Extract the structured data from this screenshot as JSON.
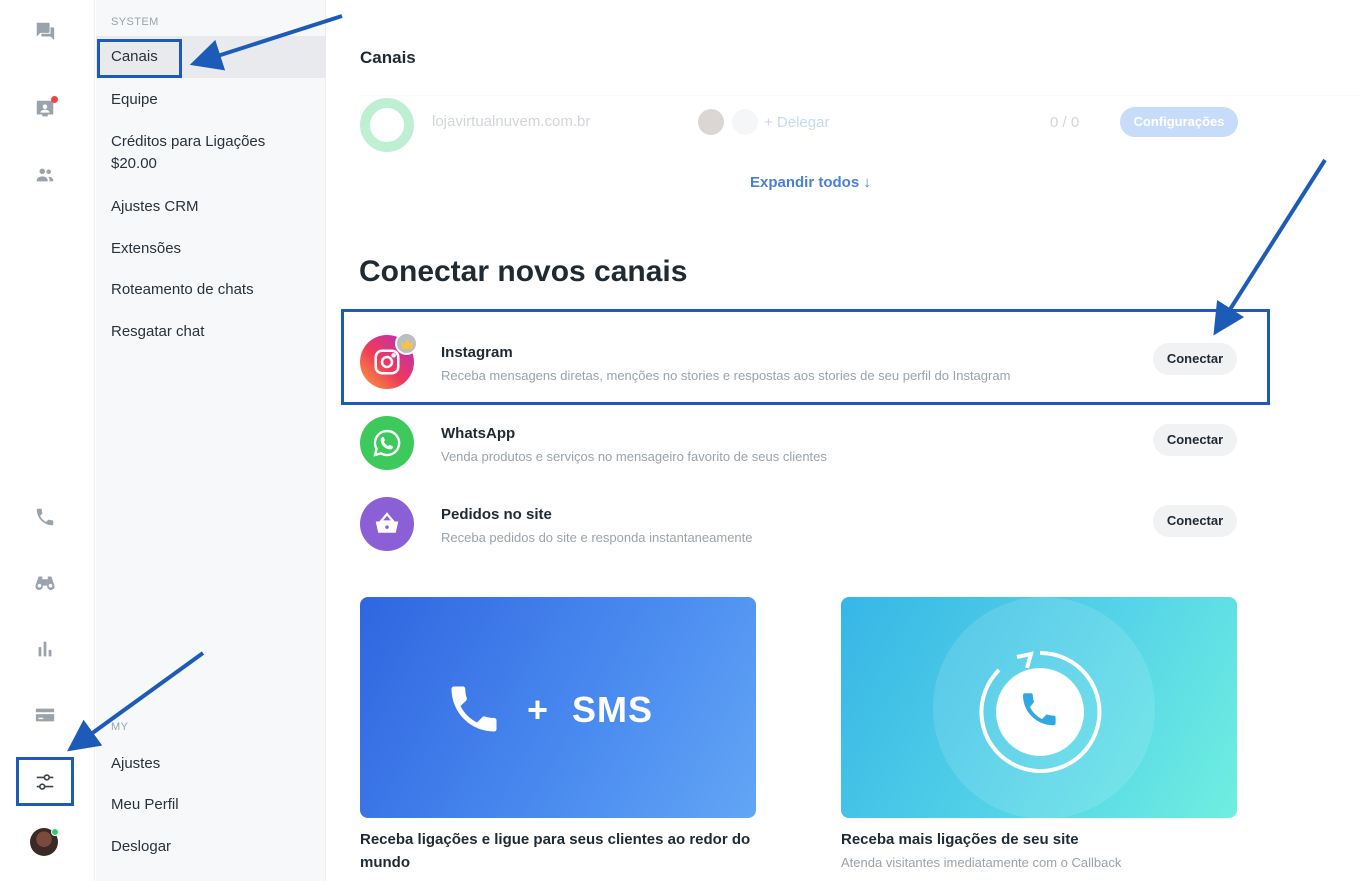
{
  "rail": {
    "icons": [
      "chat-bubbles-icon",
      "visitor-card-icon",
      "people-icon",
      "phone-icon",
      "binoculars-icon",
      "bar-chart-icon",
      "credit-card-icon",
      "sliders-icon"
    ],
    "avatar": "user-avatar"
  },
  "sidebar": {
    "system_label": "SYSTEM",
    "system_items": [
      {
        "label": "Canais",
        "active": true
      },
      {
        "label": "Equipe"
      },
      {
        "label": "Créditos para Ligações",
        "sub": "$20.00"
      },
      {
        "label": "Ajustes CRM"
      },
      {
        "label": "Extensões"
      },
      {
        "label": "Roteamento de chats"
      },
      {
        "label": "Resgatar chat"
      }
    ],
    "my_label": "MY",
    "my_items": [
      {
        "label": "Ajustes"
      },
      {
        "label": "Meu Perfil"
      },
      {
        "label": "Deslogar"
      }
    ]
  },
  "main": {
    "title": "Canais",
    "existing_channel": {
      "name": "lojavirtualnuvem.com.br",
      "delegate": "+ Delegar",
      "count": "0 / 0",
      "config_button": "Configurações"
    },
    "expand_all": "Expandir todos ↓",
    "connect_title": "Conectar novos canais",
    "connect_items": [
      {
        "title": "Instagram",
        "desc": "Receba mensagens diretas, menções no stories e respostas aos stories de seu perfil do Instagram",
        "button": "Conectar"
      },
      {
        "title": "WhatsApp",
        "desc": "Venda produtos e serviços no mensageiro favorito de seus clientes",
        "button": "Conectar"
      },
      {
        "title": "Pedidos no site",
        "desc": "Receba pedidos do site e responda instantaneamente",
        "button": "Conectar"
      }
    ],
    "promos": [
      {
        "banner_text": "+ SMS",
        "caption": "Receba ligações e ligue para seus clientes ao redor do mundo",
        "sub": ""
      },
      {
        "banner_text": "",
        "caption": "Receba mais ligações de seu site",
        "sub": "Atenda visitantes imediatamente com o Callback"
      }
    ]
  },
  "colors": {
    "annotation_blue": "#1c5cb8",
    "link_blue": "#4a7fd6",
    "whatsapp_green": "#2ecc71",
    "basket_purple": "#8b5fd6"
  }
}
